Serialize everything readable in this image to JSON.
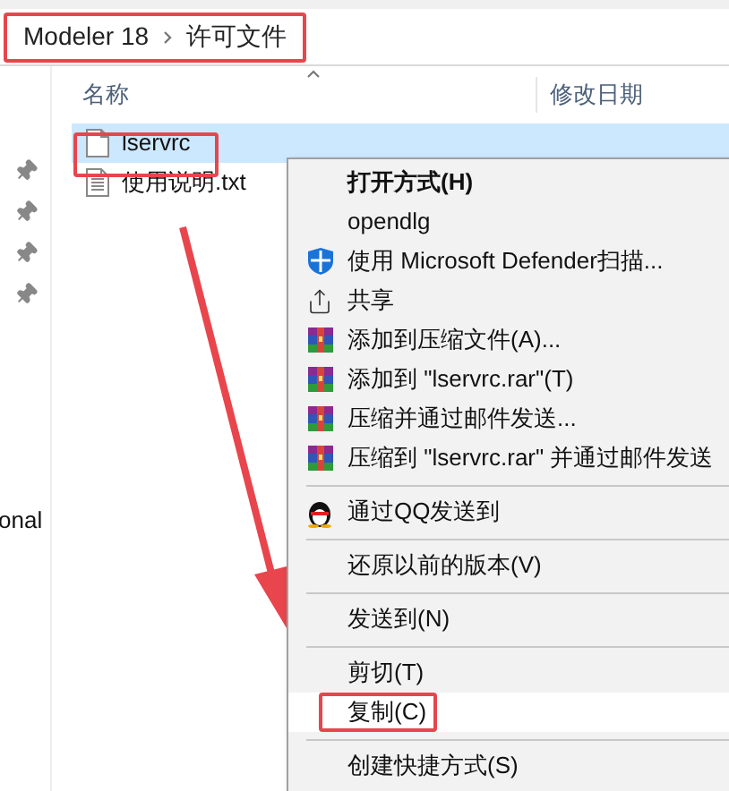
{
  "breadcrumb": [
    {
      "label": "Modeler 18"
    },
    {
      "label": "许可文件"
    }
  ],
  "columns": [
    "名称",
    "修改日期"
  ],
  "nav_fragment": "onal",
  "files": [
    {
      "name": "lservrc",
      "kind": "file",
      "selected": true
    },
    {
      "name": "使用说明.txt",
      "kind": "text",
      "selected": false
    }
  ],
  "menu": [
    {
      "kind": "bold",
      "label": "打开方式(H)",
      "selected": false
    },
    {
      "kind": "plain",
      "label": "opendlg",
      "selected": false
    },
    {
      "kind": "shield",
      "label": "使用 Microsoft Defender扫描...",
      "selected": false
    },
    {
      "kind": "share",
      "label": "共享",
      "selected": false
    },
    {
      "kind": "archive",
      "label": "添加到压缩文件(A)...",
      "selected": false
    },
    {
      "kind": "archive",
      "label": "添加到 \"lservrc.rar\"(T)",
      "selected": false
    },
    {
      "kind": "archive",
      "label": "压缩并通过邮件发送...",
      "selected": false
    },
    {
      "kind": "archive",
      "label": "压缩到 \"lservrc.rar\" 并通过邮件发送",
      "selected": false
    },
    {
      "kind": "separator"
    },
    {
      "kind": "penguin",
      "label": "通过QQ发送到",
      "selected": false
    },
    {
      "kind": "separator"
    },
    {
      "kind": "plain",
      "label": "还原以前的版本(V)",
      "selected": false
    },
    {
      "kind": "separator"
    },
    {
      "kind": "plain",
      "label": "发送到(N)",
      "selected": false
    },
    {
      "kind": "separator"
    },
    {
      "kind": "plain",
      "label": "剪切(T)",
      "selected": false
    },
    {
      "kind": "plain",
      "label": "复制(C)",
      "selected": true
    },
    {
      "kind": "separator"
    },
    {
      "kind": "plain",
      "label": "创建快捷方式(S)",
      "selected": false
    }
  ]
}
